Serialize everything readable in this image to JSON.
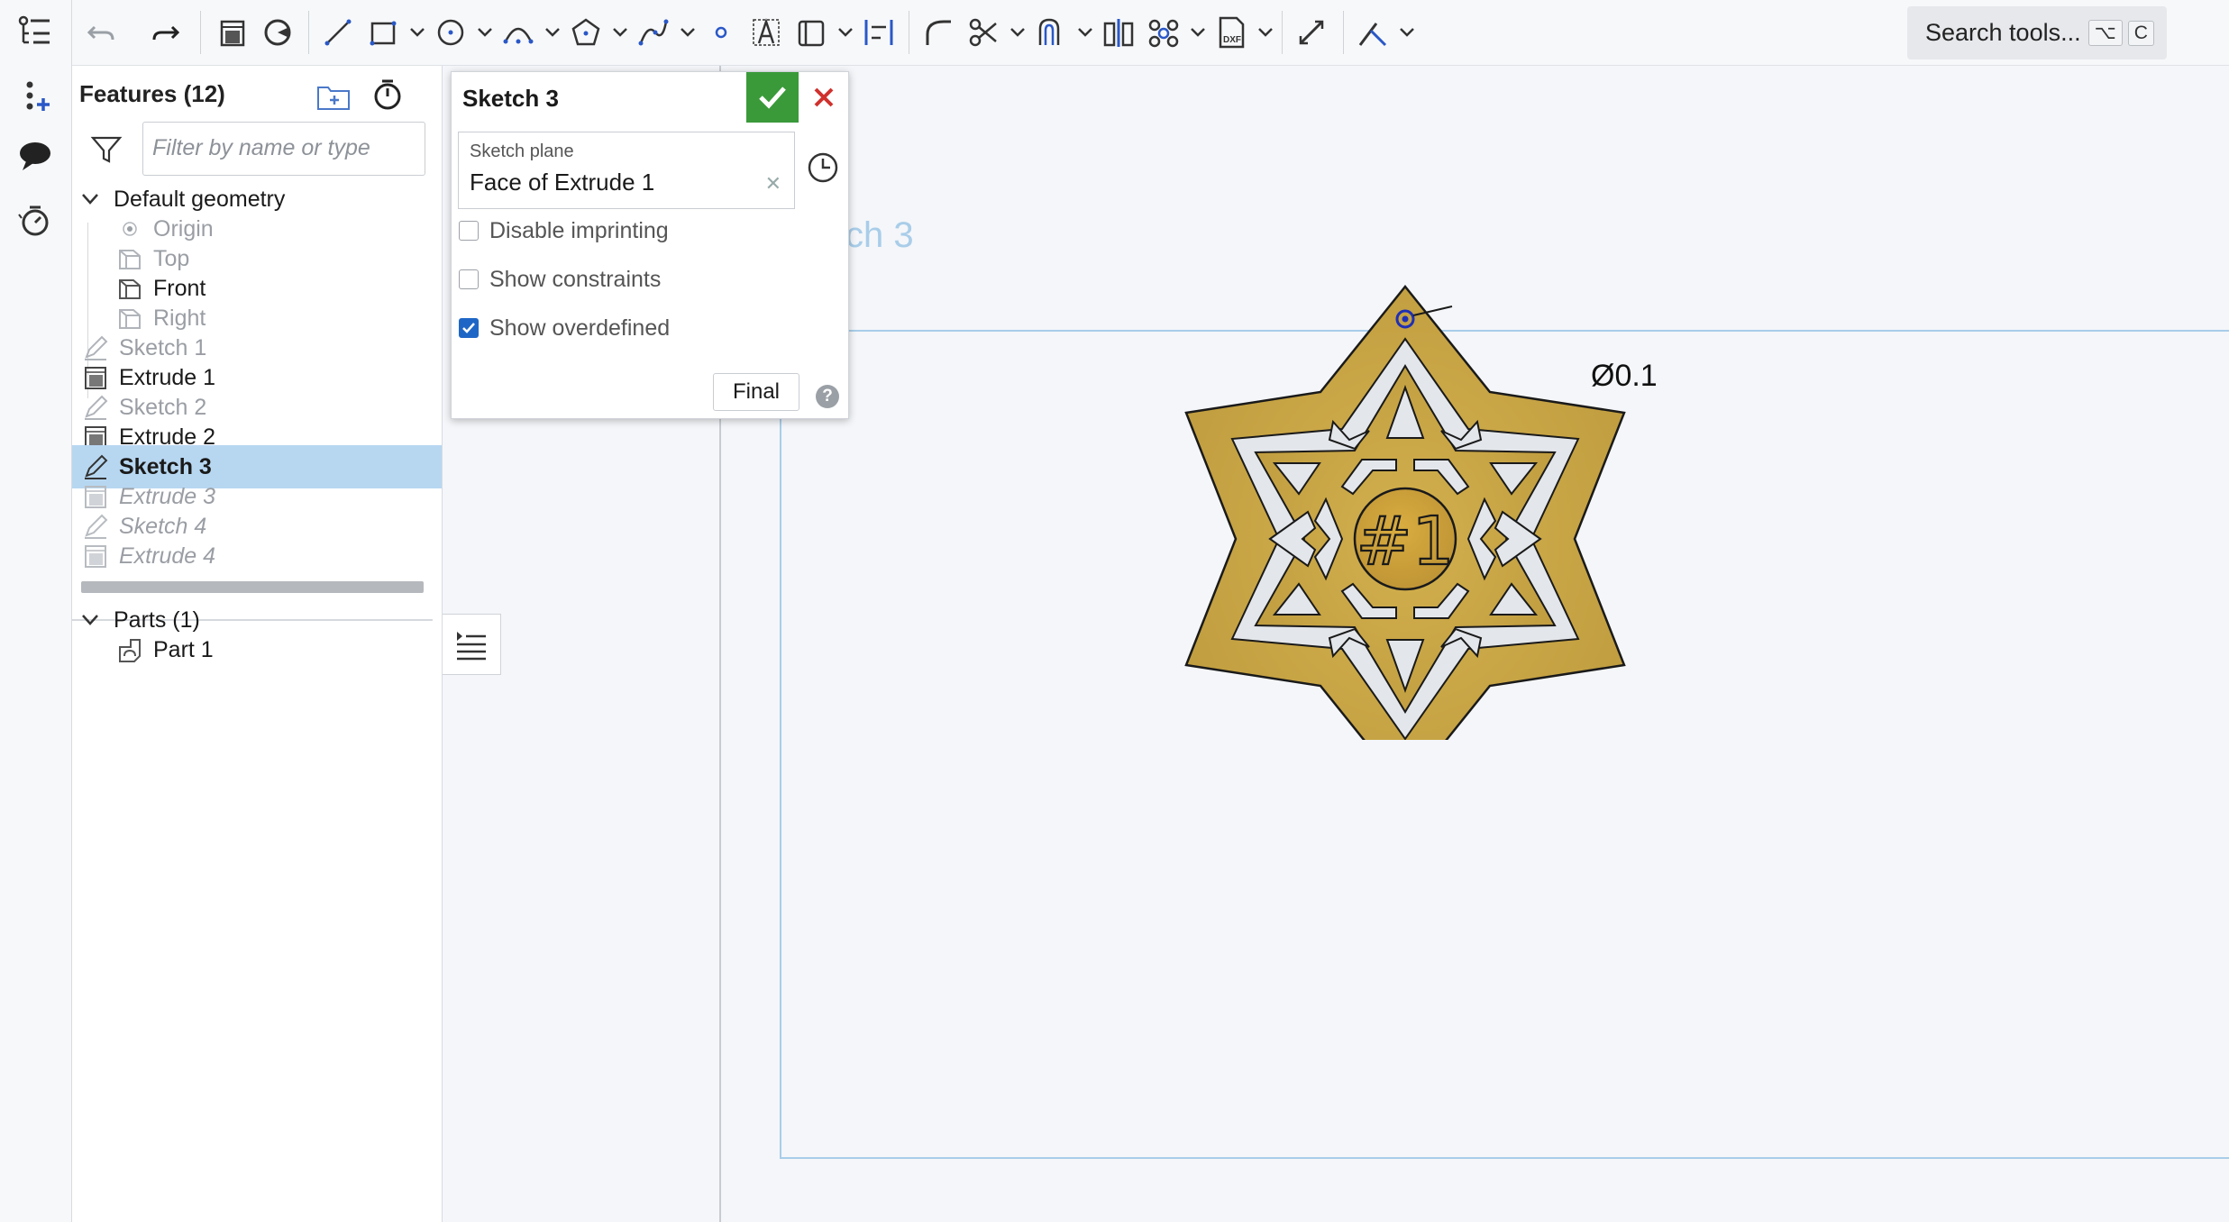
{
  "toolbar": {
    "search_label": "Search tools...",
    "shortcut_key1": "⌥",
    "shortcut_key2": "C",
    "icons": [
      "undo-icon",
      "redo-icon",
      "extrude-icon",
      "revolve-icon",
      "line-icon",
      "rectangle-icon",
      "circle-icon",
      "arc-icon",
      "polygon-icon",
      "spline-icon",
      "point-icon",
      "text-icon",
      "construction-icon",
      "align-icon",
      "fillet-icon",
      "trim-icon",
      "offset-icon",
      "mirror-icon",
      "pattern-icon",
      "dxf-icon",
      "transform-icon",
      "intersect-icon"
    ]
  },
  "features": {
    "title": "Features (12)",
    "filter_placeholder": "Filter by name or type",
    "default_geometry_label": "Default geometry",
    "items": [
      {
        "label": "Origin",
        "kind": "origin"
      },
      {
        "label": "Top",
        "kind": "plane"
      },
      {
        "label": "Front",
        "kind": "plane"
      },
      {
        "label": "Right",
        "kind": "plane"
      },
      {
        "label": "Sketch 1",
        "kind": "sketch"
      },
      {
        "label": "Extrude 1",
        "kind": "extrude"
      },
      {
        "label": "Sketch 2",
        "kind": "sketch"
      },
      {
        "label": "Extrude 2",
        "kind": "extrude"
      },
      {
        "label": "Sketch 3",
        "kind": "sketch",
        "selected": true
      },
      {
        "label": "Extrude 3",
        "kind": "extrude",
        "rolled_back": true
      },
      {
        "label": "Sketch 4",
        "kind": "sketch",
        "rolled_back": true
      },
      {
        "label": "Extrude 4",
        "kind": "extrude",
        "rolled_back": true
      }
    ],
    "parts_label": "Parts (1)",
    "part_item": "Part 1"
  },
  "sketch_dialog": {
    "title": "Sketch 3",
    "plane_label": "Sketch plane",
    "plane_value": "Face of Extrude 1",
    "disable_imprinting": "Disable imprinting",
    "show_constraints": "Show constraints",
    "show_overdefined": "Show overdefined",
    "final_label": "Final",
    "help": "?"
  },
  "canvas": {
    "sketch_label": "Sketch 3",
    "dimension_text": "Ø0.1",
    "center_text": "#1",
    "colors": {
      "gold": "#c9a646",
      "light": "#e3e6ea",
      "outline": "#1a1a1a",
      "sketch_blue": "#1f2fb5",
      "frame": "#a9cde9"
    }
  }
}
